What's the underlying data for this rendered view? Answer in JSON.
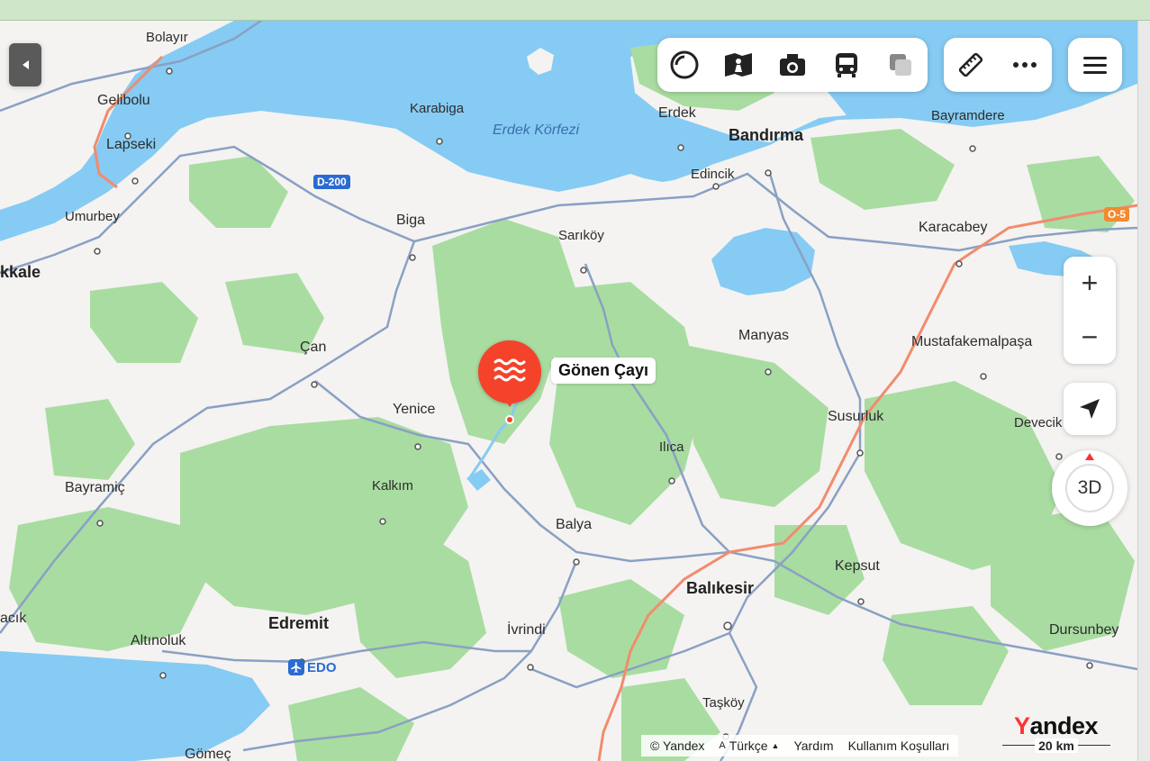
{
  "places": {
    "bolayir": "Bolayır",
    "gelibolu": "Gelibolu",
    "lapseki": "Lapseki",
    "karabiga": "Karabiga",
    "erdek_korfezi": "Erdek Körfezi",
    "erdek": "Erdek",
    "bandirma": "Bandırma",
    "edincik": "Edincik",
    "bayramdere": "Bayramdere",
    "umurbey": "Umurbey",
    "kale": "kkale",
    "biga": "Biga",
    "sarikoy": "Sarıköy",
    "karacabey": "Karacabey",
    "can": "Çan",
    "manyas": "Manyas",
    "mustafakemalpasa": "Mustafakemalpaşa",
    "yenice": "Yenice",
    "susurluk": "Susurluk",
    "devecik": "Devecik",
    "ilica": "Ilıca",
    "bayramic": "Bayramiç",
    "kalkim": "Kalkım",
    "balya": "Balya",
    "kepsut": "Kepsut",
    "balikesir": "Balıkesir",
    "acik": "acık",
    "edremit": "Edremit",
    "altinoluk": "Altınoluk",
    "ivrindi": "İvrindi",
    "dursunbey": "Dursunbey",
    "taskoy": "Taşköy",
    "gomec": "Gömeç"
  },
  "road_shields": {
    "d200": "D-200",
    "o5": "O-5"
  },
  "airport": {
    "code": "EDO"
  },
  "selected_place": {
    "name": "Gönen Çayı",
    "icon": "water-waves-icon",
    "color": "#f4422b"
  },
  "toolbar": {
    "icons": [
      "layers-circle-icon",
      "panorama-person-icon",
      "camera-icon",
      "bus-icon",
      "map-layers-icon"
    ],
    "ruler_icon": "ruler-icon",
    "more_icon": "more-dots-icon",
    "menu_icon": "hamburger-menu-icon"
  },
  "controls": {
    "zoom_in": "+",
    "zoom_out": "−",
    "locate_icon": "navigation-arrow-icon",
    "view_3d": "3D",
    "collapse_icon": "collapse-left-icon"
  },
  "footer": {
    "copyright": "© Yandex",
    "language": "Türkçe",
    "help": "Yardım",
    "terms": "Kullanım Koşulları",
    "scale": "20 km"
  },
  "brand": {
    "logo_first": "Y",
    "logo_rest": "andex"
  },
  "colors": {
    "water": "#86cbf3",
    "forest": "#a9dca1",
    "land": "#f4f3f1",
    "road": "#8aa0c4",
    "highway": "#f28b6d",
    "accent": "#f4422b"
  }
}
